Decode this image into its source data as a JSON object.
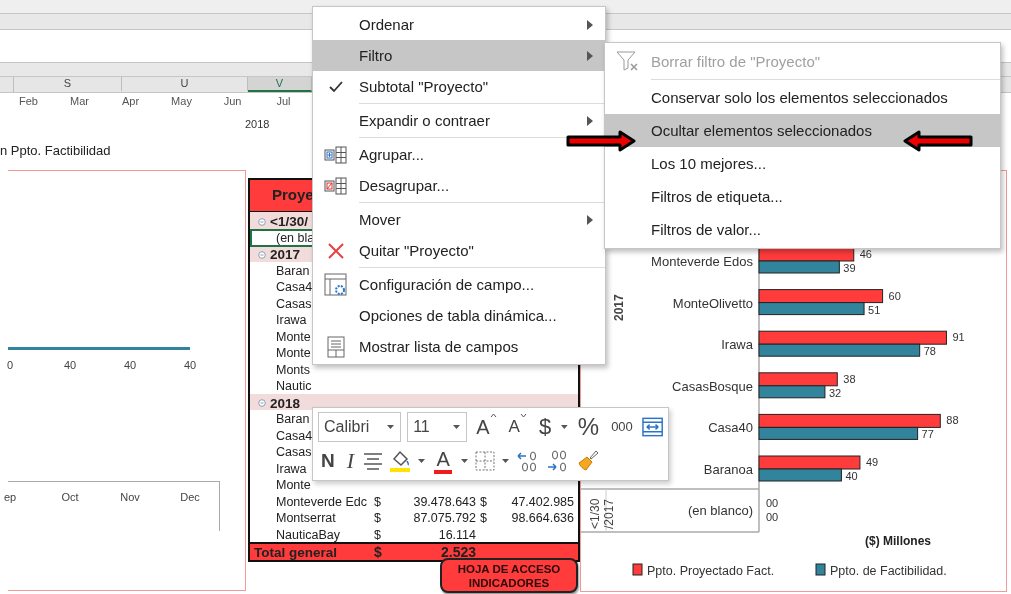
{
  "sheet": {
    "column_headers": [
      {
        "label": "S",
        "selected": false
      },
      {
        "label": "U",
        "selected": false
      },
      {
        "label": "V",
        "selected": true
      }
    ],
    "months": [
      "Feb",
      "Mar",
      "Apr",
      "May",
      "Jun",
      "Jul"
    ],
    "year": "2018",
    "caption": "n Ppto. Factibilidad"
  },
  "line_chart": {
    "value_labels": [
      "0",
      "40",
      "40",
      "40"
    ],
    "months": [
      "ep",
      "Oct",
      "Nov",
      "Dec"
    ]
  },
  "pivot": {
    "header": "Proye",
    "rows": [
      {
        "kind": "group",
        "label": "<1/30/"
      },
      {
        "kind": "item",
        "label": "(en bla",
        "selected": true
      },
      {
        "kind": "group",
        "label": "2017"
      },
      {
        "kind": "item",
        "label": "Baran",
        "selected": false
      },
      {
        "kind": "item",
        "label": "Casa4",
        "selected": false
      },
      {
        "kind": "item",
        "label": "Casas",
        "selected": false
      },
      {
        "kind": "item",
        "label": "Irawa",
        "selected": false
      },
      {
        "kind": "item",
        "label": "Monte",
        "selected": false
      },
      {
        "kind": "item",
        "label": "Monte",
        "selected": false
      },
      {
        "kind": "item",
        "label": "Monts",
        "selected": false
      },
      {
        "kind": "item",
        "label": "Nautic",
        "selected": false
      },
      {
        "kind": "group",
        "label": "2018"
      },
      {
        "kind": "item",
        "label": "Baran",
        "selected": false
      },
      {
        "kind": "item",
        "label": "Casa4",
        "selected": false
      },
      {
        "kind": "item",
        "label": "Casas",
        "selected": false
      },
      {
        "kind": "item",
        "label": "Irawa",
        "selected": false
      },
      {
        "kind": "item",
        "label": "Monte",
        "selected": false
      },
      {
        "kind": "item",
        "label": "Monteverde Edc",
        "selected": false,
        "cells": [
          "$",
          "39.478.643",
          "$",
          "47.402.985"
        ]
      },
      {
        "kind": "item",
        "label": "Montserrat",
        "selected": false,
        "cells": [
          "$",
          "87.075.792",
          "$",
          "98.664.636"
        ]
      },
      {
        "kind": "item",
        "label": "NauticaBay",
        "selected": false,
        "cells": [
          "$",
          "16.114"
        ]
      }
    ],
    "total": {
      "label": "Total general",
      "cells": [
        "$",
        "2.523"
      ]
    }
  },
  "bar_chart": {
    "chart_data": {
      "type": "bar",
      "orientation": "horizontal",
      "categories": [
        "Monteverde Edos",
        "MonteOlivetto",
        "Irawa",
        "CasasBosque",
        "Casa40",
        "Baranoa"
      ],
      "xlabel": "($) Millones",
      "data_labels": true,
      "legend": "bottom",
      "series": [
        {
          "name": "Ppto. Proyectado Fact.",
          "color": "#ff3b3b",
          "values": [
            46,
            60,
            91,
            38,
            88,
            49
          ]
        },
        {
          "name": "Ppto. de Factibilidad.",
          "color": "#31849b",
          "values": [
            39,
            51,
            78,
            32,
            77,
            40
          ]
        }
      ]
    },
    "group_label": "2017",
    "blank_row": {
      "label": "(en blanco)",
      "group_lines": [
        "<1/30",
        "/2017"
      ],
      "readings": [
        "00",
        "00"
      ]
    }
  },
  "context_menu": {
    "items": [
      {
        "kind": "item",
        "label": "Ordenar",
        "submenu": true,
        "checked": false,
        "selected": false
      },
      {
        "kind": "item",
        "label": "Filtro",
        "submenu": true,
        "checked": false,
        "selected": true
      },
      {
        "kind": "item",
        "label": "Subtotal \"Proyecto\"",
        "submenu": false,
        "checked": true,
        "selected": false
      },
      {
        "kind": "separator"
      },
      {
        "kind": "item",
        "label": "Expandir o contraer",
        "submenu": true,
        "checked": false,
        "selected": false
      },
      {
        "kind": "separator"
      },
      {
        "kind": "item",
        "label": "Agrupar...",
        "submenu": false,
        "checked": false,
        "selected": false
      },
      {
        "kind": "item",
        "label": "Desagrupar...",
        "submenu": false,
        "checked": false,
        "selected": false
      },
      {
        "kind": "separator"
      },
      {
        "kind": "item",
        "label": "Mover",
        "submenu": true,
        "checked": false,
        "selected": false
      },
      {
        "kind": "item",
        "label": "Quitar \"Proyecto\"",
        "submenu": false,
        "checked": false,
        "selected": false
      },
      {
        "kind": "separator"
      },
      {
        "kind": "item",
        "label": "Configuración de campo...",
        "submenu": false,
        "checked": false,
        "selected": false
      },
      {
        "kind": "item",
        "label": "Opciones de tabla dinámica...",
        "submenu": false,
        "checked": false,
        "selected": false
      },
      {
        "kind": "item",
        "label": "Mostrar lista de campos",
        "submenu": false,
        "checked": false,
        "selected": false
      }
    ]
  },
  "filter_submenu": {
    "items": [
      {
        "kind": "item",
        "label": "Borrar filtro de \"Proyecto\"",
        "disabled": true,
        "selected": false
      },
      {
        "kind": "separator"
      },
      {
        "kind": "item",
        "label": "Conservar solo los elementos seleccionados",
        "disabled": false,
        "selected": false
      },
      {
        "kind": "item",
        "label": "Ocultar elementos seleccionados",
        "disabled": false,
        "selected": true
      },
      {
        "kind": "item",
        "label": "Los 10 mejores...",
        "disabled": false,
        "selected": false
      },
      {
        "kind": "item",
        "label": "Filtros de etiqueta...",
        "disabled": false,
        "selected": false
      },
      {
        "kind": "item",
        "label": "Filtros de valor...",
        "disabled": false,
        "selected": false
      }
    ]
  },
  "mini_toolbar": {
    "font": "Calibri",
    "size": "11",
    "grow": "A",
    "shrink": "A",
    "currency": "$",
    "percent": "%",
    "thousands": "000",
    "bold": "N",
    "italic": "I",
    "font_color": "A"
  },
  "link_button": {
    "label": "HOJA DE ACCESO INDICADORES"
  }
}
